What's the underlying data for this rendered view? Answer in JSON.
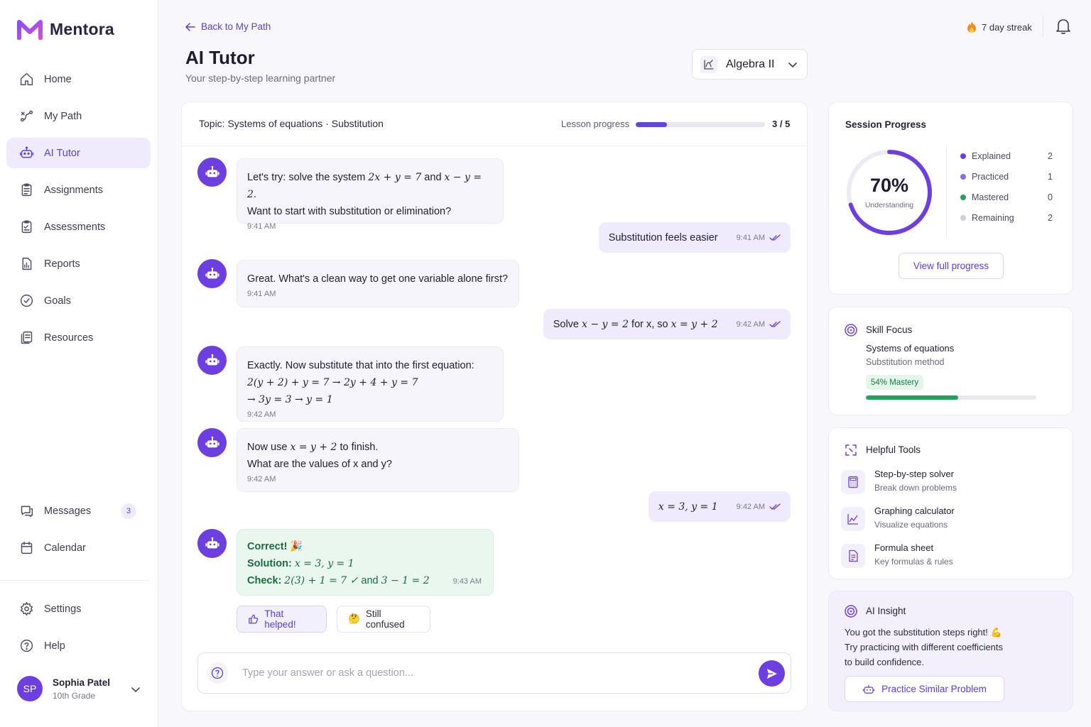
{
  "app": {
    "name": "Mentora"
  },
  "sidebar": {
    "items": [
      {
        "label": "Home",
        "icon": "home-icon"
      },
      {
        "label": "My Path",
        "icon": "path-icon"
      },
      {
        "label": "AI Tutor",
        "icon": "robot-icon",
        "active": true
      },
      {
        "label": "Assignments",
        "icon": "clipboard-icon"
      },
      {
        "label": "Assessments",
        "icon": "checklist-icon"
      },
      {
        "label": "Reports",
        "icon": "report-icon"
      },
      {
        "label": "Goals",
        "icon": "check-circle-icon"
      },
      {
        "label": "Resources",
        "icon": "files-icon"
      }
    ],
    "messages": {
      "label": "Messages",
      "count": "3"
    },
    "calendar": {
      "label": "Calendar"
    },
    "settings": {
      "label": "Settings"
    },
    "help": {
      "label": "Help"
    },
    "user": {
      "initials": "SP",
      "name": "Sophia Patel",
      "grade": "10th Grade"
    }
  },
  "header": {
    "back_label": "Back to My Path",
    "title": "AI Tutor",
    "subtitle": "Your step-by-step learning partner",
    "subject": "Algebra II",
    "streak": "7 day streak"
  },
  "chat": {
    "topic": "Topic: Systems of equations",
    "subtopic": "Substitution",
    "lesson_label": "Lesson progress",
    "lesson_done": 3,
    "lesson_total": 5,
    "lesson_count": "3 / 5",
    "messages": {
      "m1": {
        "line1a": "Let's try: solve the system ",
        "math1": "2x + y = 7",
        "and": " and ",
        "math2": "x − y = 2",
        "end": ".",
        "line2": "Want to start with substitution or elimination?",
        "time": "9:41 AM"
      },
      "u1": {
        "text": "Substitution feels easier",
        "time": "9:41 AM"
      },
      "m2": {
        "text": "Great. What's a clean way to get one variable alone first?",
        "time": "9:41 AM"
      },
      "u2": {
        "pre": "Solve ",
        "math1": "x − y = 2",
        "mid": " for x, so ",
        "math2": "x = y + 2",
        "time": "9:42 AM"
      },
      "m3": {
        "line1": "Exactly. Now substitute that into the first equation:",
        "math1": "2(y + 2) + y = 7 → 2y + 4 + y = 7",
        "math2": "→ 3y = 3 → y = 1",
        "time": "9:42 AM"
      },
      "m4": {
        "pre": "Now use ",
        "math": "x = y + 2",
        "post": " to finish.",
        "line2": "What are the values of x and y?",
        "time": "9:42 AM"
      },
      "u3": {
        "math": "x = 3,  y = 1",
        "time": "9:42 AM"
      },
      "m5": {
        "correct": "Correct! 🎉",
        "solution_label": "Solution:",
        "solution": "x = 3,  y = 1",
        "check_label": "Check:",
        "check_math1": "2(3) + 1 = 7 ✓",
        "check_and": " and ",
        "check_math2": "3 − 1 = 2",
        "time": "9:43 AM"
      }
    },
    "feedback": {
      "helped": "That helped!",
      "confused_emoji": "🤔",
      "confused": "Still confused"
    },
    "input": {
      "placeholder": "Type your answer or ask a question..."
    }
  },
  "session": {
    "title": "Session Progress",
    "percent_value": 70,
    "percent": "70%",
    "understanding": "Understanding",
    "stats": [
      {
        "label": "Explained",
        "value": "2",
        "color": "#6d3fe0"
      },
      {
        "label": "Practiced",
        "value": "1",
        "color": "#8b6cf0"
      },
      {
        "label": "Mastered",
        "value": "0",
        "color": "#22a35a"
      },
      {
        "label": "Remaining",
        "value": "2",
        "color": "#cfcfdb"
      }
    ],
    "view_button": "View full progress"
  },
  "skill": {
    "title": "Skill Focus",
    "name": "Systems of equations",
    "method": "Substitution method",
    "mastery_label": "54% Mastery",
    "mastery_value": 54
  },
  "tools": {
    "title": "Helpful Tools",
    "items": [
      {
        "name": "Step-by-step solver",
        "desc": "Break down problems",
        "icon": "calculator-icon"
      },
      {
        "name": "Graphing calculator",
        "desc": "Visualize equations",
        "icon": "graph-icon"
      },
      {
        "name": "Formula sheet",
        "desc": "Key formulas & rules",
        "icon": "document-icon"
      }
    ]
  },
  "insight": {
    "title": "AI Insight",
    "line1": "You got the substitution steps right! 💪",
    "line2": "Try practicing with different coefficients",
    "line3": "to build confidence.",
    "button": "Practice Similar Problem"
  },
  "colors": {
    "accent": "#6d3fe0",
    "success": "#22a35a"
  }
}
